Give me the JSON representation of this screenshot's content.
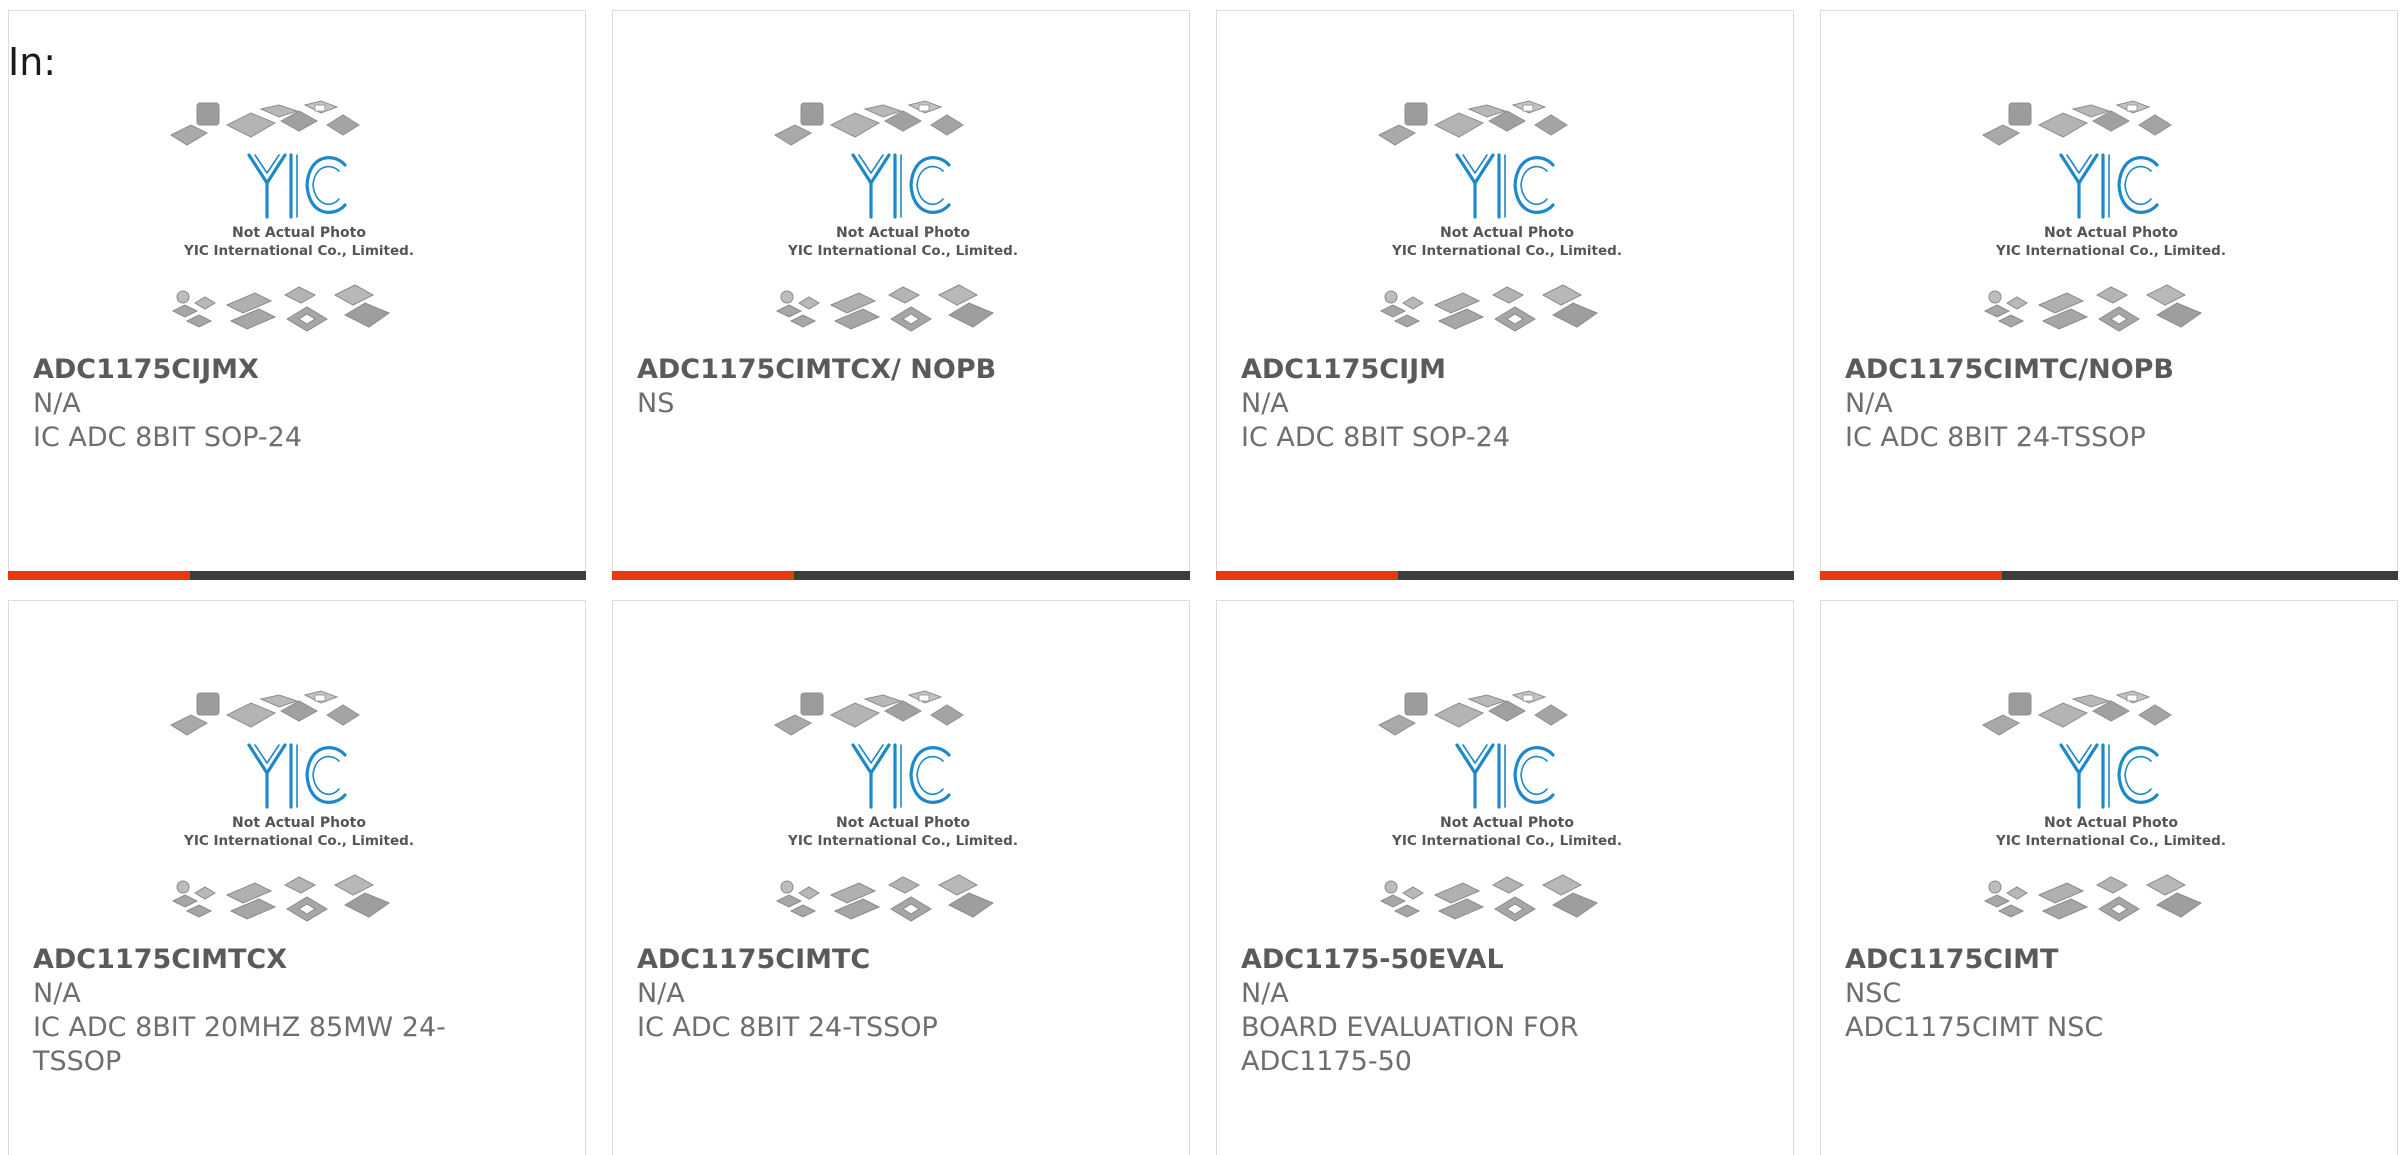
{
  "heading": "In:",
  "colors": {
    "accent": "#e8380d",
    "bar": "#3d3d3d",
    "logo_blue": "#1e88c8",
    "border": "#dcdcdc"
  },
  "photo": {
    "caption_line1": "Not Actual Photo",
    "caption_line2": "YIC International Co., Limited.",
    "logo_text": "YIC"
  },
  "products": [
    {
      "part": "ADC1175CIJMX",
      "mfr": "N/A",
      "desc": "IC ADC 8BIT SOP-24"
    },
    {
      "part": "ADC1175CIMTCX/ NOPB",
      "mfr": "NS",
      "desc": ""
    },
    {
      "part": "ADC1175CIJM",
      "mfr": "N/A",
      "desc": "IC ADC 8BIT SOP-24"
    },
    {
      "part": "ADC1175CIMTC/NOPB",
      "mfr": "N/A",
      "desc": "IC ADC 8BIT 24-TSSOP"
    },
    {
      "part": "ADC1175CIMTCX",
      "mfr": "N/A",
      "desc": "IC ADC 8BIT 20MHZ 85MW 24-TSSOP"
    },
    {
      "part": "ADC1175CIMTC",
      "mfr": "N/A",
      "desc": "IC ADC 8BIT 24-TSSOP"
    },
    {
      "part": "ADC1175-50EVAL",
      "mfr": "N/A",
      "desc": "BOARD EVALUATION FOR ADC1175-50"
    },
    {
      "part": "ADC1175CIMT",
      "mfr": "NSC",
      "desc": "ADC1175CIMT NSC"
    }
  ]
}
